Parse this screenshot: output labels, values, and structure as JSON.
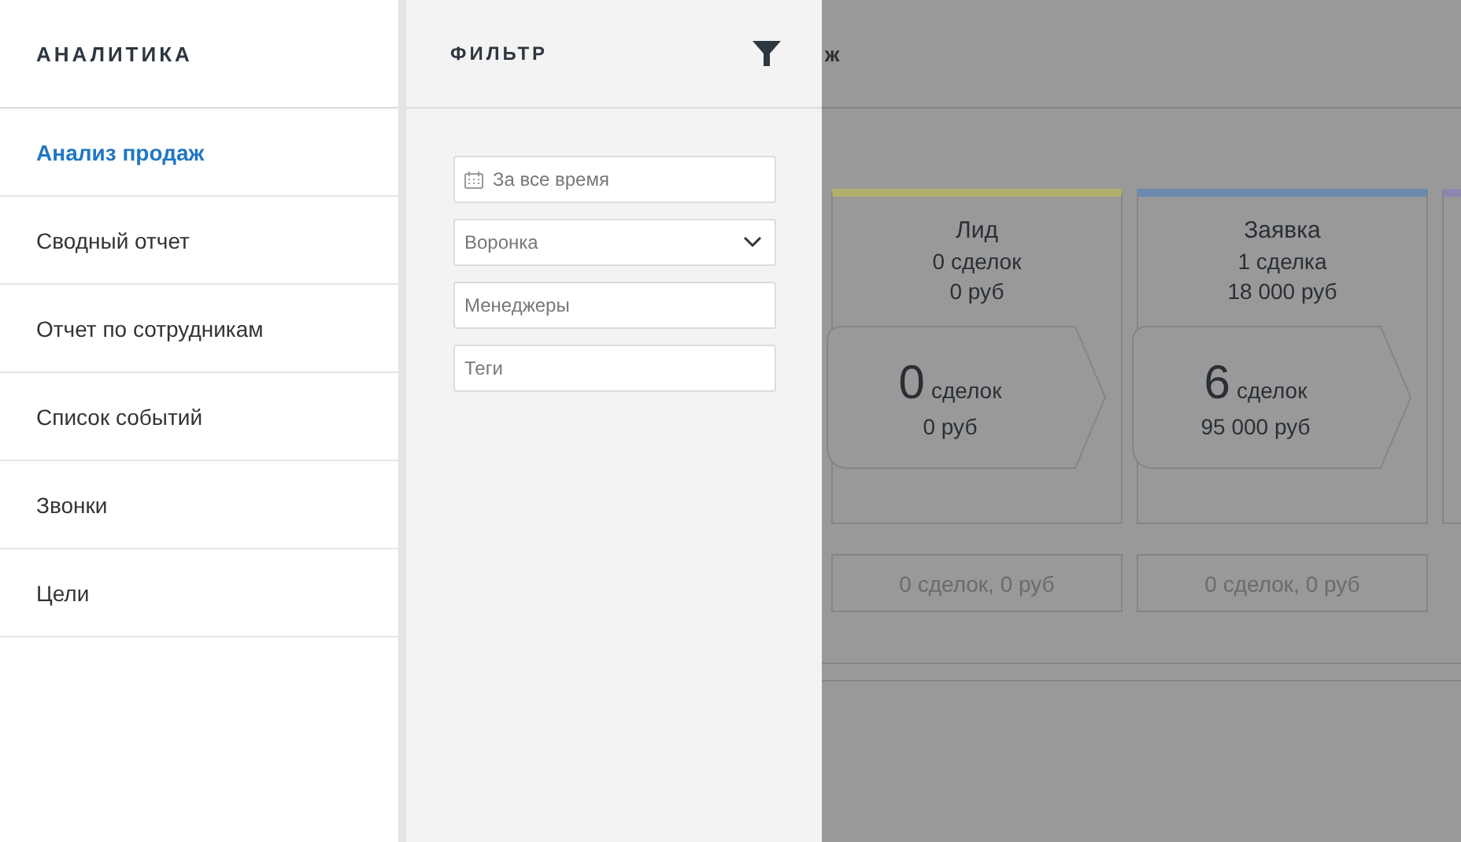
{
  "sidebar": {
    "title": "АНАЛИТИКА",
    "items": [
      {
        "label": "Анализ продаж",
        "selected": true
      },
      {
        "label": "Сводный отчет",
        "selected": false
      },
      {
        "label": "Отчет по сотрудникам",
        "selected": false
      },
      {
        "label": "Список событий",
        "selected": false
      },
      {
        "label": "Звонки",
        "selected": false
      },
      {
        "label": "Цели",
        "selected": false
      }
    ]
  },
  "filter": {
    "title": "ФИЛЬТР",
    "fields": [
      {
        "kind": "date",
        "placeholder": "За все время"
      },
      {
        "kind": "select",
        "placeholder": "Воронка"
      },
      {
        "kind": "text",
        "placeholder": "Менеджеры"
      },
      {
        "kind": "text",
        "placeholder": "Теги"
      }
    ]
  },
  "background": {
    "title": "ж",
    "stages": [
      {
        "name": "Лид",
        "color": "#b1af6c",
        "deals": "0 сделок",
        "amount": "0 руб",
        "total_count": "0",
        "total_unit": "сделок",
        "total_amount": "0 руб",
        "lost": "0 сделок, 0 руб"
      },
      {
        "name": "Заявка",
        "color": "#6a8ab0",
        "deals": "1 сделка",
        "amount": "18 000 руб",
        "total_count": "6",
        "total_unit": "сделок",
        "total_amount": "95 000 руб",
        "lost": "0 сделок, 0 руб"
      },
      {
        "color": "#8f86b0"
      }
    ]
  }
}
